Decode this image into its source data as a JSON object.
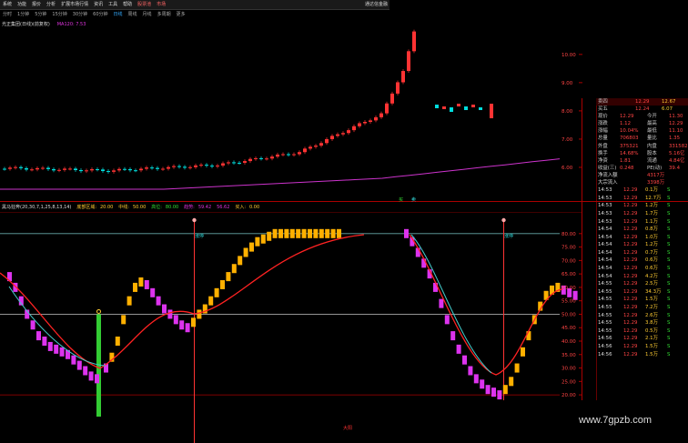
{
  "menu": {
    "items": [
      "系统",
      "功能",
      "报价",
      "分析",
      "扩展市场行情",
      "资讯",
      "工具",
      "帮助",
      "股票池",
      "市场"
    ],
    "brand": "通达信金融"
  },
  "periods": {
    "items": [
      "分时",
      "1分钟",
      "5分钟",
      "15分钟",
      "30分钟",
      "60分钟",
      "日线",
      "周线",
      "月线",
      "多周期",
      "更多"
    ],
    "active_index": 6
  },
  "chart_title": "光正集团(日线)(前复权)",
  "ma_label": "MA120: 7.53",
  "kline_axis": {
    "ticks": [
      "10.00",
      "9.00",
      "8.00",
      "7.00",
      "6.00"
    ],
    "range": [
      5.0,
      10.8
    ]
  },
  "kline_markers": [
    "买",
    "卖"
  ],
  "indicator": {
    "name": "黑马狂奔(20,30,7,1,25,8,13,14)",
    "param1_label": "底部区域:",
    "param1_value": "20.00",
    "param2_label": "中线:",
    "param2_value": "50.00",
    "param3_label": "高位:",
    "param3_value": "80.00",
    "param4_label": "趋势:",
    "param4_value": "59.42",
    "param5_value": "56.62",
    "buy_label": "买入:",
    "buy_value": "0.00",
    "axis_ticks": [
      "80.00",
      "75.00",
      "70.00",
      "65.00",
      "60.00",
      "55.00",
      "50.00",
      "45.00",
      "40.00",
      "35.00",
      "30.00",
      "25.00",
      "20.00"
    ],
    "axis_range": [
      18,
      84
    ],
    "marker_labels": [
      "涨停",
      "涨停"
    ],
    "bottom_label": "大阳"
  },
  "quote": {
    "sell4": {
      "label": "卖四",
      "price": "12.29",
      "vol": "12.67"
    },
    "buy1": {
      "label": "买五",
      "price": "12.24",
      "vol": "6.07"
    },
    "rows": [
      {
        "l1": "现价",
        "v1": "12.29",
        "l2": "今开",
        "v2": "11.30"
      },
      {
        "l1": "涨跌",
        "v1": "1.12",
        "l2": "最高",
        "v2": "12.29"
      },
      {
        "l1": "涨幅",
        "v1": "10.04%",
        "l2": "最低",
        "v2": "11.10"
      },
      {
        "l1": "总量",
        "v1": "706803",
        "l2": "量比",
        "v2": "1.35"
      },
      {
        "l1": "外盘",
        "v1": "375321",
        "l2": "内盘",
        "v2": "331582"
      },
      {
        "l1": "换手",
        "v1": "14.68%",
        "l2": "股本",
        "v2": "5.16亿"
      },
      {
        "l1": "净资",
        "v1": "1.81",
        "l2": "流通",
        "v2": "4.84亿"
      },
      {
        "l1": "收益(三)",
        "v1": "0.248",
        "l2": "PE(动)",
        "v2": "39.4"
      }
    ],
    "flow": [
      {
        "label": "净流入额",
        "value": "4317万"
      },
      {
        "label": "大宗流入",
        "value": "3398万"
      }
    ],
    "sell_prices": [
      {
        "price": "12.29",
        "vol": "1.3"
      },
      {
        "price": "12.29",
        "vol": "1.3"
      },
      {
        "price": "12.29",
        "vol": "1.0"
      }
    ],
    "buy_prices": [
      {
        "price": "12.24",
        "vol": "6.0"
      },
      {
        "price": "12.24",
        "vol": "6.0"
      }
    ]
  },
  "ticks": [
    {
      "time": "14:53",
      "price": "12.29",
      "vol": "0.1万",
      "dir": "S"
    },
    {
      "time": "14:53",
      "price": "12.29",
      "vol": "12.7万",
      "dir": "S"
    },
    {
      "time": "14:53",
      "price": "12.29",
      "vol": "1.2万",
      "dir": "S"
    },
    {
      "time": "14:53",
      "price": "12.29",
      "vol": "1.7万",
      "dir": "S"
    },
    {
      "time": "14:53",
      "price": "12.29",
      "vol": "1.1万",
      "dir": "S"
    },
    {
      "time": "14:54",
      "price": "12.29",
      "vol": "0.8万",
      "dir": "S"
    },
    {
      "time": "14:54",
      "price": "12.29",
      "vol": "1.0万",
      "dir": "S"
    },
    {
      "time": "14:54",
      "price": "12.29",
      "vol": "1.2万",
      "dir": "S"
    },
    {
      "time": "14:54",
      "price": "12.29",
      "vol": "0.7万",
      "dir": "S"
    },
    {
      "time": "14:54",
      "price": "12.29",
      "vol": "0.6万",
      "dir": "S"
    },
    {
      "time": "14:54",
      "price": "12.29",
      "vol": "0.6万",
      "dir": "S"
    },
    {
      "time": "14:54",
      "price": "12.29",
      "vol": "4.2万",
      "dir": "S"
    },
    {
      "time": "14:55",
      "price": "12.29",
      "vol": "2.5万",
      "dir": "S"
    },
    {
      "time": "14:55",
      "price": "12.29",
      "vol": "34.3万",
      "dir": "S"
    },
    {
      "time": "14:55",
      "price": "12.29",
      "vol": "1.5万",
      "dir": "S"
    },
    {
      "time": "14:55",
      "price": "12.29",
      "vol": "7.2万",
      "dir": "S"
    },
    {
      "time": "14:55",
      "price": "12.29",
      "vol": "2.6万",
      "dir": "S"
    },
    {
      "time": "14:55",
      "price": "12.29",
      "vol": "3.8万",
      "dir": "S"
    },
    {
      "time": "14:55",
      "price": "12.29",
      "vol": "0.5万",
      "dir": "S"
    },
    {
      "time": "14:56",
      "price": "12.29",
      "vol": "2.1万",
      "dir": "S"
    },
    {
      "time": "14:56",
      "price": "12.29",
      "vol": "1.5万",
      "dir": "S"
    },
    {
      "time": "14:56",
      "price": "12.29",
      "vol": "1.5万",
      "dir": "S"
    }
  ],
  "watermark": "www.7gpzb.com",
  "colors": {
    "up": "#ff3333",
    "down": "#00dddd",
    "ma": "#cc33cc",
    "accent": "#ffcc00",
    "bull_bar": "#ffb000",
    "bear_bar": "#dd33ee",
    "signal_green": "#33cc33"
  }
}
